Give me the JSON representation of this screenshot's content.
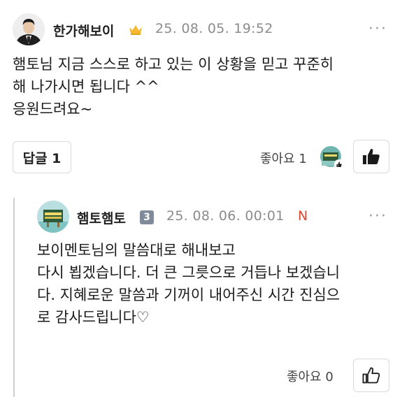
{
  "comment": {
    "author": "한가해보이",
    "date": "25. 08. 05. 19:52",
    "more": "···",
    "lines": [
      "햄토님 지금 스스로 하고 있는 이 상황을 믿고 꾸준히",
      "해 나가시면 됩니다 ^^",
      "응원드려요~"
    ],
    "reply_label": "답글 1",
    "like_label": "좋아요 1",
    "crown_color": "#f5b82e"
  },
  "reply": {
    "author": "햄토햄토",
    "level": "3",
    "date": "25. 08. 06. 00:01",
    "new_badge": "N",
    "more": "···",
    "lines": [
      "보이멘토님의 말씀대로 해내보고",
      "다시 뵙겠습니다. 더 큰 그릇으로 거듭나 보겠습니",
      "다. 지혜로운 말씀과 기꺼이 내어주신 시간 진심으",
      "로 감사드립니다♡"
    ],
    "like_label": "좋아요 0",
    "new_color": "#e0452b",
    "level_color": "#7f8a9a"
  }
}
